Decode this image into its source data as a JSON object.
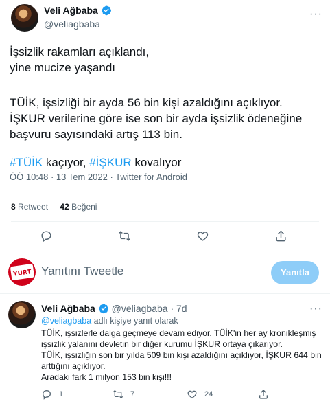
{
  "tweet": {
    "author_name": "Veli Ağbaba",
    "author_handle": "@veliagbaba",
    "text_lines": [
      "İşsizlik rakamları açıklandı,",
      "yine mucize yaşandı",
      "",
      "TÜİK, işsizliği bir ayda 56 bin kişi azaldığını açıklıyor.",
      "İŞKUR verilerine göre ise son bir ayda işsizlik ödeneğine",
      "başvuru sayısındaki artış 113 bin."
    ],
    "hashtag_line": {
      "tag1": "#TÜİK",
      "mid": " kaçıyor, ",
      "tag2": "#İŞKUR",
      "end": " kovalıyor"
    },
    "meta": "ÖÖ 10:48 · 13 Tem 2022 · Twitter for Android",
    "stats": {
      "retweets_count": "8",
      "retweets_label": "Retweet",
      "likes_count": "42",
      "likes_label": "Beğeni"
    }
  },
  "reply_box": {
    "placeholder": "Yanıtını Tweetle",
    "button_label": "Yanıtla",
    "avatar_text": "YURT"
  },
  "reply": {
    "author_name": "Veli Ağbaba",
    "author_handle": "@veliagbaba",
    "time": "· 7d",
    "reply_to_handle": "@veliagbaba",
    "reply_to_suffix": " adlı kişiye yanıt olarak",
    "text_lines": [
      "TÜİK, işsizlerle dalga geçmeye devam ediyor. TÜİK'in her ay kronikleşmiş",
      "işsizlik yalanını devletin bir diğer kurumu İŞKUR ortaya çıkarıyor.",
      "TÜİK, işsizliğin son bir yılda 509 bin kişi azaldığını açıklıyor, İŞKUR 644 bin",
      "arttığını açıklıyor.",
      "Aradaki fark 1 milyon 153 bin kişi!!!"
    ],
    "reply_count": "1",
    "retweet_count": "7",
    "like_count": "24"
  },
  "colors": {
    "accent": "#1d9bf0",
    "muted": "#536471",
    "reply_button": "#8ecdf8",
    "yurt_red": "#d0021b"
  }
}
